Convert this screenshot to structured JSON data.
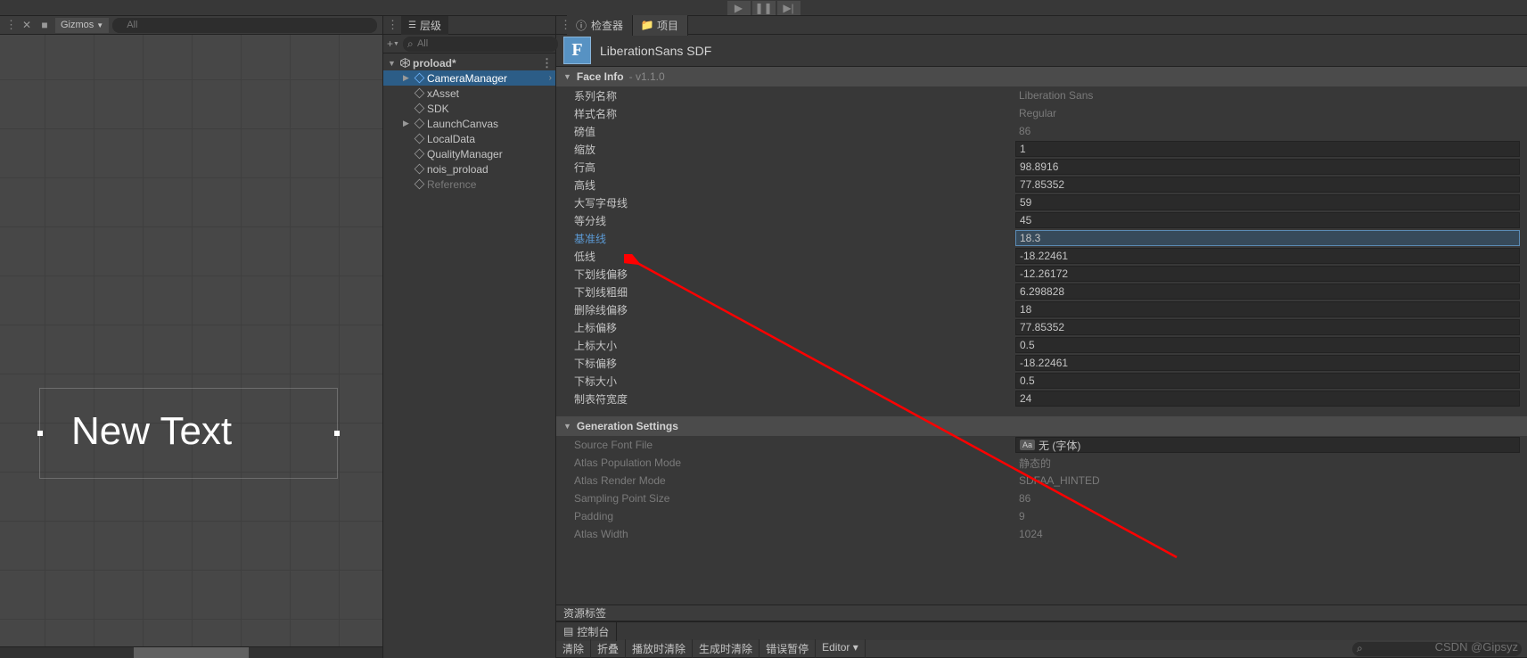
{
  "scene": {
    "gizmos_label": "Gizmos",
    "search_placeholder": "All",
    "new_text": "New Text"
  },
  "hierarchy": {
    "tab_label": "层级",
    "search_placeholder": "All",
    "scene_name": "proload*",
    "items": [
      {
        "label": "CameraManager",
        "selected": true,
        "expand": true,
        "chev": true
      },
      {
        "label": "xAsset"
      },
      {
        "label": "SDK"
      },
      {
        "label": "LaunchCanvas",
        "expand": true
      },
      {
        "label": "LocalData"
      },
      {
        "label": "QualityManager"
      },
      {
        "label": "nois_proload"
      },
      {
        "label": "Reference",
        "disabled": true
      }
    ]
  },
  "inspector": {
    "tabs": [
      {
        "label": "检查器",
        "icon": "info",
        "active": true
      },
      {
        "label": "项目",
        "icon": "folder"
      }
    ],
    "asset_name": "LiberationSans SDF",
    "face_info_title": "Face Info",
    "face_info_version": " - v1.1.0",
    "face_info": [
      {
        "label": "系列名称",
        "value": "Liberation Sans",
        "readonly": true
      },
      {
        "label": "样式名称",
        "value": "Regular",
        "readonly": true
      },
      {
        "label": "磅值",
        "value": "86",
        "readonly": true
      },
      {
        "label": "缩放",
        "value": "1"
      },
      {
        "label": "行高",
        "value": "98.8916"
      },
      {
        "label": "高线",
        "value": "77.85352"
      },
      {
        "label": "大写字母线",
        "value": "59"
      },
      {
        "label": "等分线",
        "value": "45"
      },
      {
        "label": "基准线",
        "value": "18.3",
        "highlight": true,
        "selected": true
      },
      {
        "label": "低线",
        "value": "-18.22461"
      },
      {
        "label": "下划线偏移",
        "value": "-12.26172"
      },
      {
        "label": "下划线粗细",
        "value": "6.298828"
      },
      {
        "label": "删除线偏移",
        "value": "18"
      },
      {
        "label": "上标偏移",
        "value": "77.85352"
      },
      {
        "label": "上标大小",
        "value": "0.5"
      },
      {
        "label": "下标偏移",
        "value": "-18.22461"
      },
      {
        "label": "下标大小",
        "value": "0.5"
      },
      {
        "label": "制表符宽度",
        "value": "24"
      }
    ],
    "gen_settings_title": "Generation Settings",
    "gen_settings": [
      {
        "label": "Source Font File",
        "value": "无 (字体)",
        "obj": true
      },
      {
        "label": "Atlas Population Mode",
        "value": "静态的",
        "readonly": true
      },
      {
        "label": "Atlas Render Mode",
        "value": "SDFAA_HINTED",
        "readonly": true
      },
      {
        "label": "Sampling Point Size",
        "value": "86",
        "readonly": true
      },
      {
        "label": "Padding",
        "value": "9",
        "readonly": true
      },
      {
        "label": "Atlas Width",
        "value": "1024",
        "readonly": true
      }
    ],
    "asset_labels_title": "资源标签"
  },
  "console": {
    "tab_label": "控制台",
    "buttons": [
      "清除",
      "折叠",
      "播放时清除",
      "生成时清除",
      "错误暂停",
      "Editor ▾"
    ],
    "search_placeholder": ""
  },
  "watermark": "CSDN @Gipsyz"
}
